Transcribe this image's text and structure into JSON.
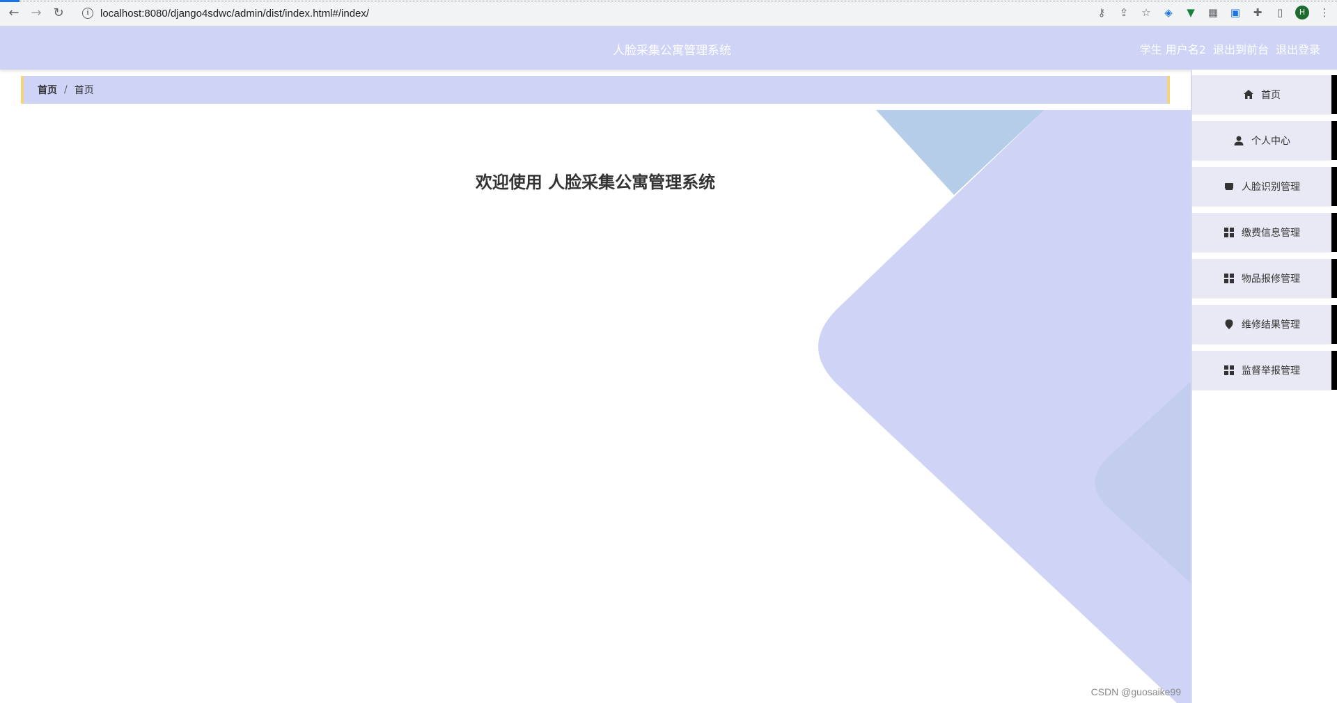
{
  "browser": {
    "url": "localhost:8080/django4sdwc/admin/dist/index.html#/index/",
    "avatar_letter": "H"
  },
  "header": {
    "title": "人脸采集公寓管理系统",
    "user_role": "学生",
    "username": "用户名2",
    "back_to_front": "退出到前台",
    "logout": "退出登录"
  },
  "breadcrumb": {
    "home": "首页",
    "current": "首页"
  },
  "main": {
    "welcome": "欢迎使用 人脸采集公寓管理系统"
  },
  "menu": {
    "items": [
      {
        "label": "首页",
        "icon": "home-icon"
      },
      {
        "label": "个人中心",
        "icon": "user-icon"
      },
      {
        "label": "人脸识别管理",
        "icon": "inbox-icon"
      },
      {
        "label": "缴费信息管理",
        "icon": "grid-icon"
      },
      {
        "label": "物品报修管理",
        "icon": "grid-icon"
      },
      {
        "label": "维修结果管理",
        "icon": "location-pin-icon"
      },
      {
        "label": "监督举报管理",
        "icon": "grid-icon"
      }
    ]
  },
  "watermark": "CSDN @guosaike99",
  "colors": {
    "header_bg": "#cfd3f5",
    "breadcrumb_border": "#f4d37a",
    "menu_bg": "#e8e9f4",
    "shape_blue": "#b5cde9"
  }
}
